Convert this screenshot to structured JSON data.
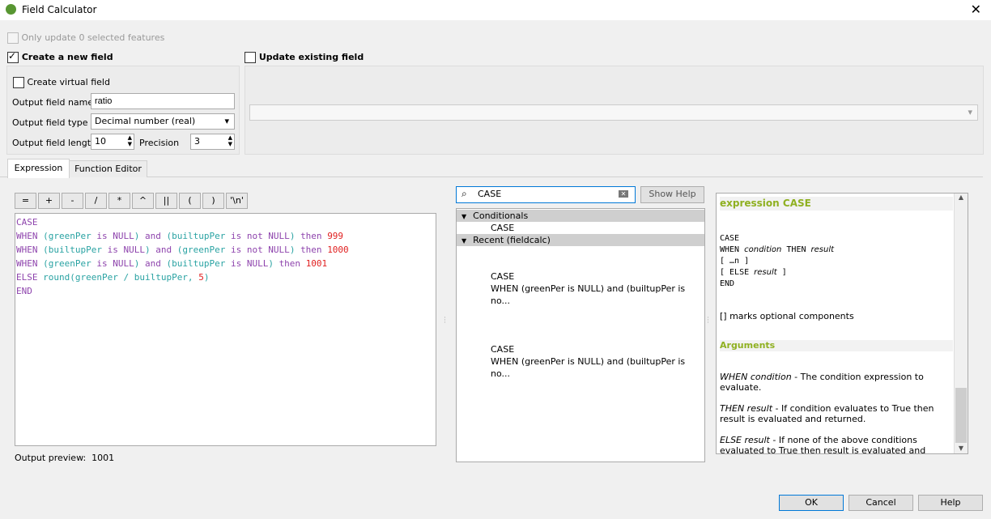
{
  "window": {
    "title": "Field Calculator",
    "close_icon": "close-icon"
  },
  "only_update": "Only update 0 selected features",
  "create_new": {
    "label": "Create a new field",
    "checked": true,
    "virtual": "Create virtual field",
    "name_label": "Output field name",
    "name_value": "ratio",
    "type_label": "Output field type",
    "type_value": "Decimal number (real)",
    "length_label": "Output field length",
    "length_value": "10",
    "precision_label": "Precision",
    "precision_value": "3"
  },
  "update_existing": {
    "label": "Update existing field",
    "checked": false,
    "value": ""
  },
  "tabs": [
    {
      "label": "Expression",
      "active": true
    },
    {
      "label": "Function Editor",
      "active": false
    }
  ],
  "operators": [
    "=",
    "+",
    "-",
    "/",
    "*",
    "^",
    "||",
    "(",
    ")",
    "'\\n'"
  ],
  "expression_lines": [
    [
      [
        "kw",
        "CASE"
      ]
    ],
    [
      [
        "kw",
        "WHEN "
      ],
      [
        "fld",
        "(greenPer "
      ],
      [
        "kw",
        "is NULL"
      ],
      [
        "fld",
        ") "
      ],
      [
        "kw",
        "and "
      ],
      [
        "fld",
        "(builtupPer "
      ],
      [
        "kw",
        "is not NULL"
      ],
      [
        "fld",
        ") "
      ],
      [
        "kw",
        "then "
      ],
      [
        "num",
        "999"
      ]
    ],
    [
      [
        "kw",
        "WHEN "
      ],
      [
        "fld",
        "(builtupPer "
      ],
      [
        "kw",
        "is NULL"
      ],
      [
        "fld",
        ") "
      ],
      [
        "kw",
        "and "
      ],
      [
        "fld",
        "(greenPer "
      ],
      [
        "kw",
        "is not NULL"
      ],
      [
        "fld",
        ") "
      ],
      [
        "kw",
        "then "
      ],
      [
        "num",
        "1000"
      ]
    ],
    [
      [
        "kw",
        "WHEN "
      ],
      [
        "fld",
        "(greenPer "
      ],
      [
        "kw",
        "is NULL"
      ],
      [
        "fld",
        ") "
      ],
      [
        "kw",
        "and "
      ],
      [
        "fld",
        "(builtupPer "
      ],
      [
        "kw",
        "is NULL"
      ],
      [
        "fld",
        ") "
      ],
      [
        "kw",
        "then "
      ],
      [
        "num",
        "1001"
      ]
    ],
    [
      [
        "kw",
        "ELSE "
      ],
      [
        "fld",
        "round(greenPer / builtupPer, "
      ],
      [
        "num",
        "5"
      ],
      [
        "fld",
        ")"
      ]
    ],
    [
      [
        "kw",
        "END"
      ]
    ]
  ],
  "output_preview": {
    "label": "Output preview:",
    "value": "1001"
  },
  "search": {
    "value": "CASE",
    "show_help": "Show Help"
  },
  "tree": {
    "group1": "Conditionals",
    "item1": "CASE",
    "group2": "Recent (fieldcalc)",
    "recent": [
      {
        "l1": "CASE",
        "l2": "WHEN (greenPer is NULL) and (builtupPer is no..."
      },
      {
        "l1": "CASE",
        "l2": "WHEN (greenPer is NULL) and (builtupPer is no..."
      }
    ]
  },
  "help": {
    "title": "expression CASE",
    "syntax": {
      "l1": "CASE",
      "l2a": "WHEN",
      "l2b": "condition",
      "l2c": "THEN",
      "l2d": "result",
      "l3": "[ …n ]",
      "l4a": "[ ELSE",
      "l4b": "result",
      "l4c": "]",
      "l5": "END"
    },
    "note": "[] marks optional components",
    "args_title": "Arguments",
    "args": [
      {
        "name": "WHEN condition",
        "text": " - The condition expression to evaluate."
      },
      {
        "name": "THEN result",
        "text": " - If condition evaluates to True then result is evaluated and returned."
      },
      {
        "name": "ELSE result",
        "text": " - If none of the above conditions evaluated to True then result is evaluated and returned."
      }
    ]
  },
  "buttons": {
    "ok": "OK",
    "cancel": "Cancel",
    "help": "Help"
  }
}
